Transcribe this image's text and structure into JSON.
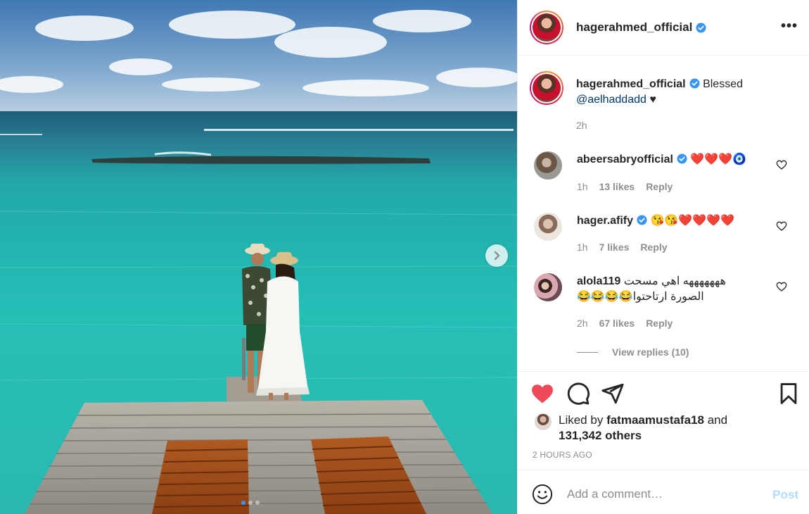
{
  "post": {
    "author": "hagerahmed_official",
    "caption_text": "Blessed",
    "caption_mention": "@aelhaddadd",
    "caption_heart": "♥",
    "caption_time": "2h",
    "more_label": "•••"
  },
  "comments": [
    {
      "username": "abeersabryofficial",
      "text": "❤️❤️❤️🧿",
      "time": "1h",
      "likes": "13 likes",
      "reply": "Reply",
      "verified": true
    },
    {
      "username": "hager.afify",
      "text": "😘😘❤️❤️❤️❤️",
      "time": "1h",
      "likes": "7 likes",
      "reply": "Reply",
      "verified": true
    },
    {
      "username": "alola119",
      "text": "هههههههه اهي مسحت الصورة ارتاحتوا😂😂😂😂",
      "time": "2h",
      "likes": "67 likes",
      "reply": "Reply",
      "verified": false
    }
  ],
  "view_replies": "View replies (10)",
  "likes": {
    "prefix": "Liked by",
    "user": "fatmaamustafa18",
    "and": "and",
    "others": "131,342 others"
  },
  "posted_ago": "2 HOURS AGO",
  "add_comment": {
    "placeholder": "Add a comment…",
    "post_label": "Post"
  },
  "colors": {
    "heart_red": "#ed4956",
    "verified_blue": "#3897f0",
    "mention_blue": "#00376b",
    "post_disabled": "#b3dbff"
  },
  "icons": {
    "like": "heart-filled-icon",
    "comment": "speech-bubble-icon",
    "share": "paper-plane-icon",
    "save": "bookmark-icon",
    "emoji": "smiley-icon",
    "next": "chevron-right-icon"
  },
  "carousel": {
    "active_index": 1,
    "count": 3
  }
}
